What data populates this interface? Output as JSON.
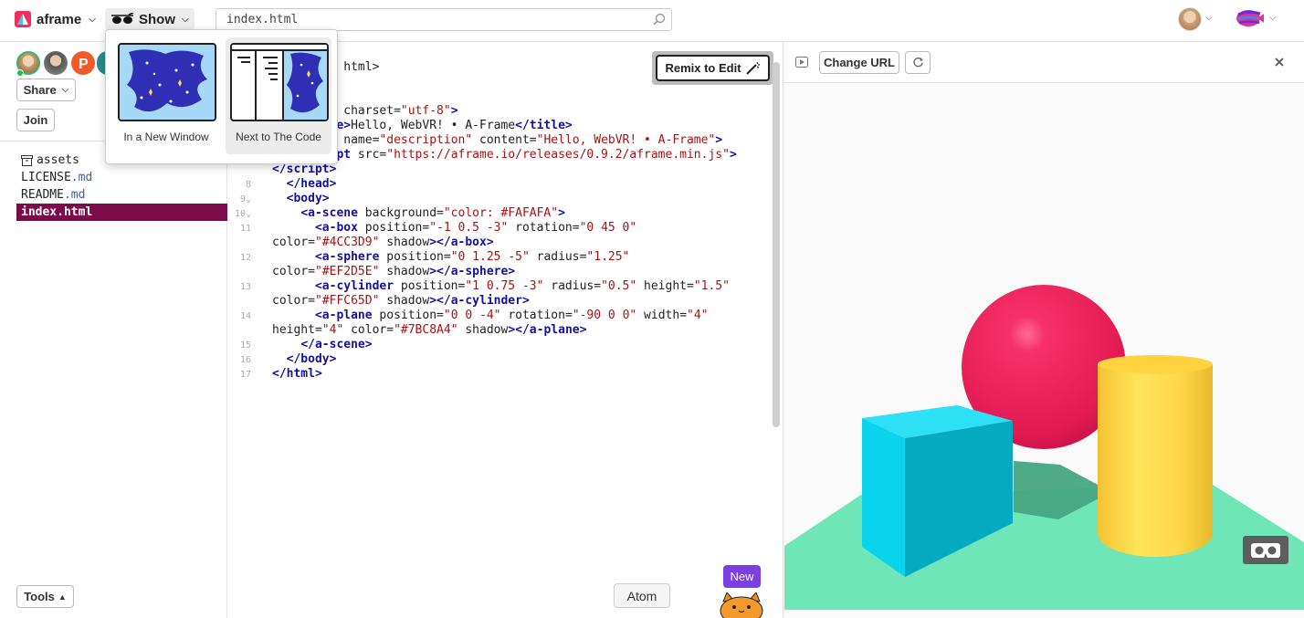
{
  "header": {
    "project_name": "aframe",
    "show_label": "Show",
    "url_value": "index.html"
  },
  "show_menu": {
    "options": [
      {
        "label": "In a New Window"
      },
      {
        "label": "Next to The Code"
      }
    ]
  },
  "sidebar": {
    "share_label": "Share",
    "join_label": "Join",
    "tools_label": "Tools",
    "files": [
      {
        "name": "assets",
        "ext": "",
        "icon": "archive-icon"
      },
      {
        "name": "LICENSE",
        "ext": ".md"
      },
      {
        "name": "README",
        "ext": ".md"
      },
      {
        "name": "index.html",
        "ext": "",
        "active": true
      }
    ]
  },
  "editor": {
    "remix_label": "Remix to Edit",
    "atom_label": "Atom",
    "new_badge": "New"
  },
  "preview": {
    "change_url_label": "Change URL"
  },
  "colors": {
    "active_file": "#7d0a4a",
    "box": "#4CC3D9",
    "sphere": "#EF2D5E",
    "cylinder": "#FFC65D",
    "plane": "#7BC8A4",
    "new_badge": "#7b3fe4"
  }
}
